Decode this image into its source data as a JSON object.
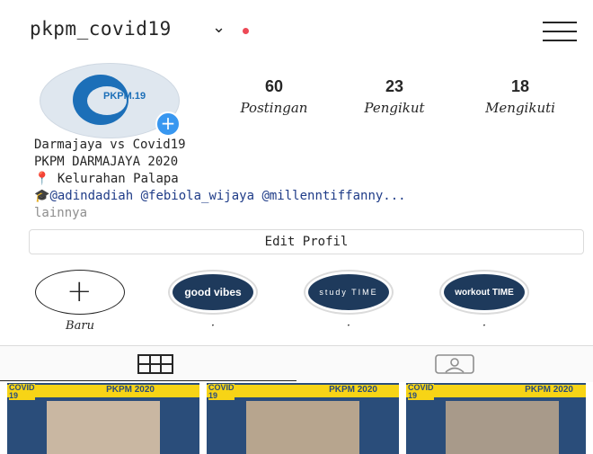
{
  "header": {
    "username": "pkpm_covid19",
    "chevron_glyph": "⌄",
    "menu_icon": "hamburger-menu-icon"
  },
  "profile": {
    "avatar_logo_text": "PKPM.19",
    "avatar_badge": "+",
    "stats": [
      {
        "value": "60",
        "label": "Postingan"
      },
      {
        "value": "23",
        "label": "Pengikut"
      },
      {
        "value": "18",
        "label": "Mengikuti"
      }
    ],
    "bio": {
      "line1": "Darmajaya vs Covid19",
      "line2": "PKPM DARMAJAYA 2020",
      "pin_icon": "📍",
      "location": " Kelurahan Palapa",
      "cap_icon": "🎓",
      "mentions": "@adindadiah @febiola_wijaya @millenntiffanny...",
      "more": "lainnya"
    },
    "edit_button": "Edit Profil"
  },
  "highlights": [
    {
      "label": "Baru",
      "text": "+"
    },
    {
      "label": "·",
      "text": "good vibes"
    },
    {
      "label": "·",
      "text": "study TIME"
    },
    {
      "label": "·",
      "text": "workout TIME"
    }
  ],
  "tabs": {
    "grid_icon": "grid-icon",
    "tagged_icon": "tagged-person-icon"
  },
  "posts": [
    {
      "badge": "COVID",
      "badge_num": "19",
      "title": "PKPM 2020"
    },
    {
      "badge": "COVID",
      "badge_num": "19",
      "title": "PKPM 2020"
    },
    {
      "badge": "COVID",
      "badge_num": "19",
      "title": "PKPM 2020"
    }
  ],
  "colors": {
    "accent_blue": "#3897f0",
    "notification_dot": "#ed4956",
    "highlight_navy": "#1e3a5c",
    "post_yellow": "#f7d416",
    "post_navy": "#2a4d7a"
  }
}
